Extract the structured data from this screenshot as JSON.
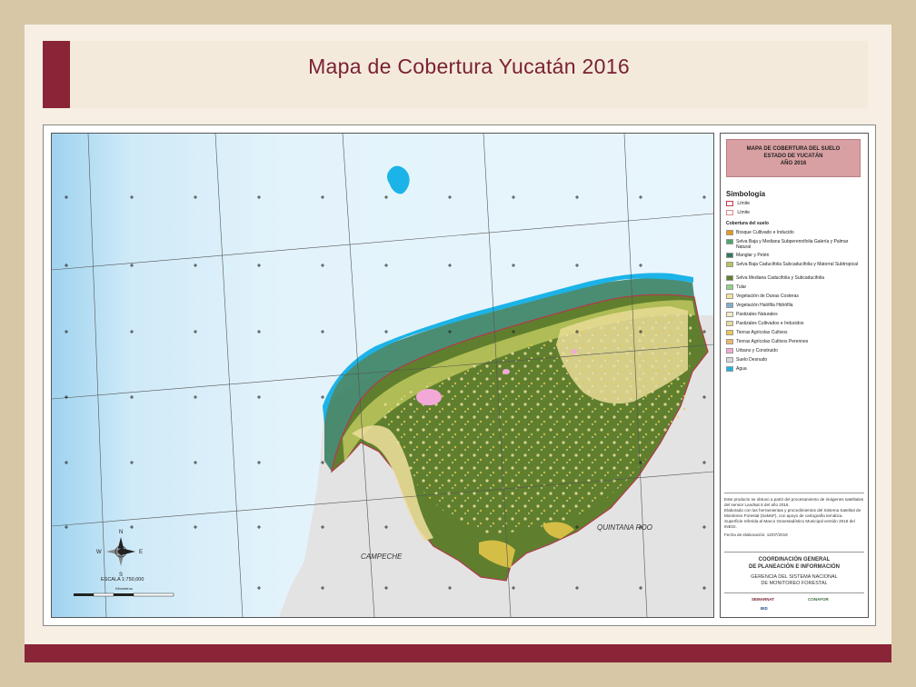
{
  "slide_title": "Mapa de Cobertura Yucatán 2016",
  "map": {
    "labels": {
      "campeche": "CAMPECHE",
      "quintana_roo": "QUINTANA ROO"
    },
    "scale": {
      "label": "ESCALA  1:750,000",
      "units": "Kilómetros"
    },
    "north_arrow": {
      "n": "N",
      "s": "S",
      "e": "E",
      "w": "W"
    }
  },
  "legend": {
    "title_lines": [
      "MAPA DE COBERTURA DEL SUELO",
      "ESTADO DE YUCATÁN",
      "AÑO 2016"
    ],
    "simbologia": "Simbología",
    "limit_items": [
      {
        "label": "Límite",
        "color": "#c23a4a"
      },
      {
        "label": "Límite",
        "color": "#d98a8a"
      }
    ],
    "cobertura_header": "Cobertura del suelo",
    "items": [
      {
        "label": "Bosque Cultivado e Inducido",
        "color": "#e89a1c"
      },
      {
        "label": "Selva Baja y Mediana Subperennifolia Galería y Palmar Natural",
        "color": "#4ba66a"
      },
      {
        "label": "Manglar y Petén",
        "color": "#2f7a5a"
      },
      {
        "label": "Selva Baja Caducifolia Subcaducifolia y Matorral Subtropical",
        "color": "#b9c35a"
      },
      {
        "label": "Selva Mediana Caducifolia y Subcaducifolia",
        "color": "#5f7f2e"
      },
      {
        "label": "Tular",
        "color": "#8fd48a"
      },
      {
        "label": "Vegetación de Dunas Costeras",
        "color": "#f3e3a0"
      },
      {
        "label": "Vegetación Halófila Hidrófila",
        "color": "#7fb0c8"
      },
      {
        "label": "Pastizales Naturales",
        "color": "#f6ecc4"
      },
      {
        "label": "Pastizales Cultivados e Inducidos",
        "color": "#e9dc98"
      },
      {
        "label": "Tierras Agrícolas Cultivos",
        "color": "#eac94a"
      },
      {
        "label": "Tierras Agrícolas Cultivos Perennes",
        "color": "#f2b96b"
      },
      {
        "label": "Urbano y Construido",
        "color": "#f3a9d8"
      },
      {
        "label": "Suelo Desnudo",
        "color": "#d6d6d6"
      },
      {
        "label": "Agua",
        "color": "#1bb3e8"
      }
    ],
    "notes": [
      "Este producto se obtuvo a partir del procesamiento de imágenes satelitales del sensor Landsat 8 del año 2016.",
      "Elaborado con las herramientas y procedimientos del Sistema Satelital de Monitoreo Forestal (SaMoF), con apoyo de cartografía temática.",
      "Superficie referida al Marco Geoestadístico Municipal versión 2016 del INEGI.",
      "Fecha de elaboración:  12/07/2019"
    ],
    "coordination": [
      "COORDINACIÓN GENERAL",
      "DE PLANEACIÓN E INFORMACIÓN"
    ],
    "gerencia": [
      "GERENCIA DEL SISTEMA NACIONAL",
      "DE MONITOREO FORESTAL"
    ],
    "logos": {
      "semarnat": "SEMARNAT",
      "conafor": "CONAFOR",
      "bid": "BID"
    }
  },
  "colors": {
    "sea_light": "#dff1fb",
    "sea_mid": "#bfe3f6",
    "neighbor_land": "#e3e3e3",
    "state_border": "#b23a48",
    "forest": "#5f7f2e",
    "accent": "#8a2538"
  }
}
